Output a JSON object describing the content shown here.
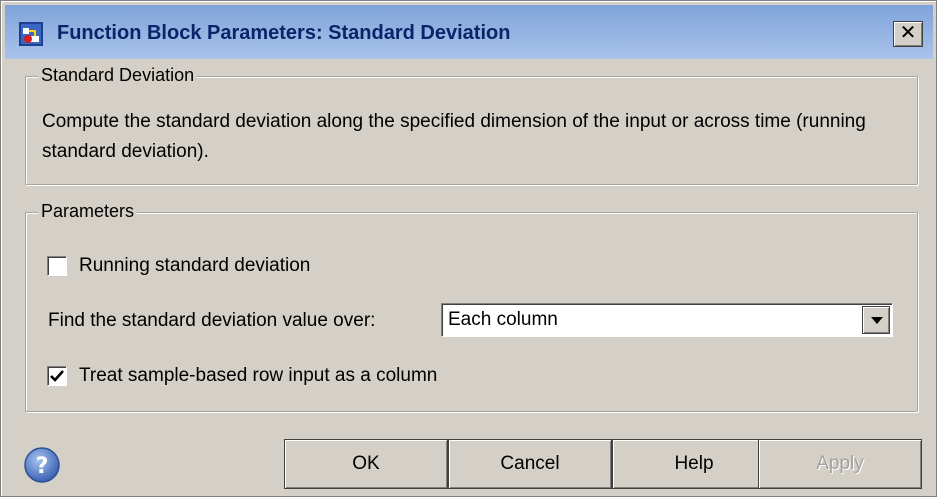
{
  "window": {
    "title": "Function Block Parameters: Standard Deviation",
    "close_glyph": "✕"
  },
  "description_group": {
    "title": "Standard Deviation",
    "text": "Compute the standard deviation along the specified dimension of the input or across time (running standard deviation)."
  },
  "parameters_group": {
    "title": "Parameters",
    "running_checkbox": {
      "label": "Running standard deviation",
      "checked": false
    },
    "dimension_select": {
      "label": "Find the standard deviation value over:",
      "value": "Each column"
    },
    "treat_row_checkbox": {
      "label": "Treat sample-based row input as a column",
      "checked": true
    }
  },
  "buttons": {
    "ok": "OK",
    "cancel": "Cancel",
    "help": "Help",
    "apply": "Apply"
  },
  "icons": {
    "title": "simulink-block-icon",
    "help": "help-question-icon",
    "dropdown": "chevron-down-icon"
  },
  "colors": {
    "dialog_bg": "#d4d0c8",
    "titlebar_start": "#7fa3d9",
    "titlebar_end": "#a9c3eb",
    "title_text": "#0a246a"
  }
}
